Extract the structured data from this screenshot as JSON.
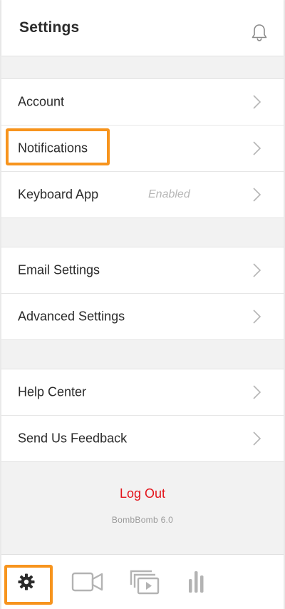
{
  "header": {
    "title": "Settings",
    "bell_icon": "bell-icon"
  },
  "groups": [
    {
      "rows": [
        {
          "label": "Account",
          "status": ""
        },
        {
          "label": "Notifications",
          "status": ""
        },
        {
          "label": "Keyboard App",
          "status": "Enabled"
        }
      ]
    },
    {
      "rows": [
        {
          "label": "Email Settings",
          "status": ""
        },
        {
          "label": "Advanced Settings",
          "status": ""
        }
      ]
    },
    {
      "rows": [
        {
          "label": "Help Center",
          "status": ""
        },
        {
          "label": "Send Us Feedback",
          "status": ""
        }
      ]
    }
  ],
  "footer": {
    "logout_label": "Log Out",
    "version": "BombBomb 6.0"
  },
  "tabbar": {
    "tabs": [
      {
        "icon": "gear-icon",
        "active": true
      },
      {
        "icon": "video-camera-icon",
        "active": false
      },
      {
        "icon": "video-library-icon",
        "active": false
      },
      {
        "icon": "analytics-bars-icon",
        "active": false
      }
    ]
  },
  "colors": {
    "accent_highlight": "#f7941d",
    "logout": "#e3141b",
    "background": "#f2f2f2"
  }
}
